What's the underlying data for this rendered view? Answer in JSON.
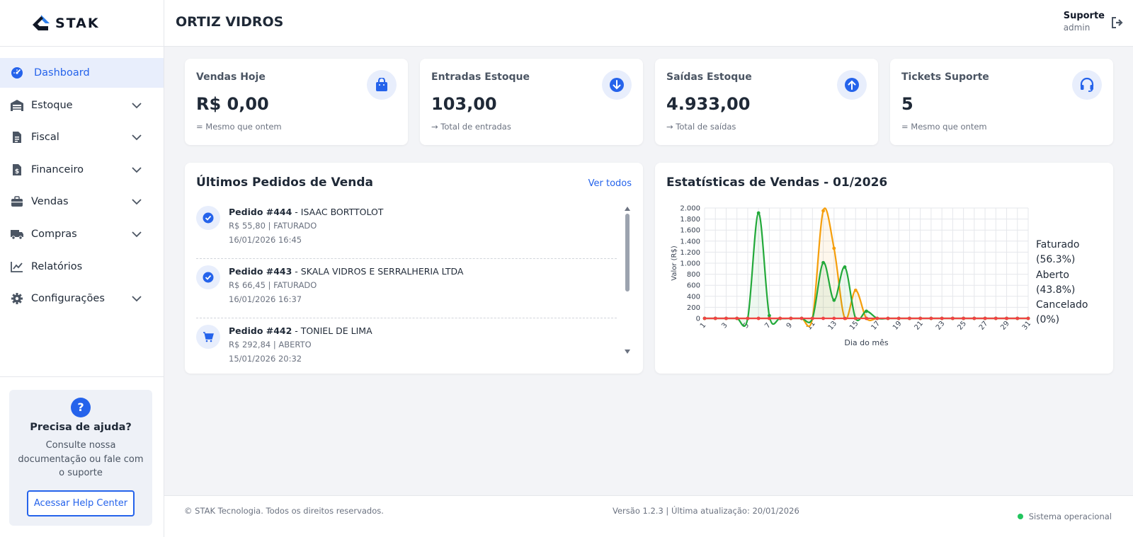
{
  "brand": {
    "name": "STAK"
  },
  "sidebar": {
    "items": [
      {
        "label": "Dashboard",
        "icon": "dashboard-icon",
        "active": true,
        "expandable": false
      },
      {
        "label": "Estoque",
        "icon": "warehouse-icon",
        "expandable": true
      },
      {
        "label": "Fiscal",
        "icon": "document-icon",
        "expandable": true
      },
      {
        "label": "Financeiro",
        "icon": "invoice-dollar-icon",
        "expandable": true
      },
      {
        "label": "Vendas",
        "icon": "briefcase-icon",
        "expandable": true
      },
      {
        "label": "Compras",
        "icon": "truck-icon",
        "expandable": true
      },
      {
        "label": "Relatórios",
        "icon": "line-chart-icon",
        "expandable": false
      },
      {
        "label": "Configurações",
        "icon": "gear-icon",
        "expandable": true
      }
    ],
    "help": {
      "icon": "?",
      "title": "Precisa de ajuda?",
      "text": "Consulte nossa documentação ou fale com o suporte",
      "button": "Acessar Help Center"
    }
  },
  "header": {
    "title": "ORTIZ VIDROS",
    "user_name": "Suporte",
    "user_role": "admin"
  },
  "stats": [
    {
      "title": "Vendas Hoje",
      "value": "R$ 0,00",
      "foot_icon": "=",
      "foot": "Mesmo que ontem",
      "icon": "shopping-bag-icon"
    },
    {
      "title": "Entradas Estoque",
      "value": "103,00",
      "foot_icon": "→",
      "foot": "Total de entradas",
      "icon": "arrow-down-circle-icon"
    },
    {
      "title": "Saídas Estoque",
      "value": "4.933,00",
      "foot_icon": "→",
      "foot": "Total de saídas",
      "icon": "arrow-up-circle-icon"
    },
    {
      "title": "Tickets Suporte",
      "value": "5",
      "foot_icon": "=",
      "foot": "Mesmo que ontem",
      "icon": "headset-icon"
    }
  ],
  "orders_panel": {
    "title": "Últimos Pedidos de Venda",
    "link": "Ver todos",
    "orders": [
      {
        "label": "Pedido #444",
        "customer": "ISAAC BORTTOLOT",
        "info": "R$ 55,80 | FATURADO",
        "date": "16/01/2026 16:45",
        "icon": "check-circle-icon"
      },
      {
        "label": "Pedido #443",
        "customer": "SKALA VIDROS E SERRALHERIA LTDA",
        "info": "R$ 66,45 | FATURADO",
        "date": "16/01/2026 16:37",
        "icon": "check-circle-icon"
      },
      {
        "label": "Pedido #442",
        "customer": "TONIEL DE LIMA",
        "info": "R$ 292,84 | ABERTO",
        "date": "15/01/2026 20:32",
        "icon": "cart-icon"
      }
    ]
  },
  "stats_panel": {
    "title": "Estatísticas de Vendas - 01/2026",
    "legend": [
      "Faturado",
      "(56.3%)",
      "Aberto",
      "(43.8%)",
      "Cancelado",
      "(0%)"
    ]
  },
  "chart_data": {
    "type": "line",
    "xlabel": "Dia do mês",
    "ylabel": "Valor (R$)",
    "x": [
      1,
      2,
      3,
      4,
      5,
      6,
      7,
      8,
      9,
      10,
      11,
      12,
      13,
      14,
      15,
      16,
      17,
      18,
      19,
      20,
      21,
      22,
      23,
      24,
      25,
      26,
      27,
      28,
      29,
      30,
      31
    ],
    "x_tick_labels": [
      "1",
      "3",
      "5",
      "7",
      "9",
      "11",
      "13",
      "15",
      "17",
      "19",
      "21",
      "23",
      "25",
      "27",
      "29",
      "31"
    ],
    "ylim": [
      0,
      2000
    ],
    "y_ticks": [
      "0",
      "200",
      "400",
      "600",
      "800",
      "1.000",
      "1.200",
      "1.400",
      "1.600",
      "1.800",
      "2.000"
    ],
    "grid": true,
    "series": [
      {
        "color": "#22a93a",
        "values": [
          0,
          0,
          0,
          0,
          0,
          1910,
          50,
          0,
          0,
          0,
          0,
          1010,
          330,
          930,
          0,
          130,
          0,
          0,
          0,
          0,
          0,
          0,
          0,
          0,
          0,
          0,
          0,
          0,
          0,
          0,
          0
        ]
      },
      {
        "color": "#f59e0b",
        "values": [
          0,
          0,
          0,
          0,
          0,
          0,
          0,
          0,
          0,
          0,
          0,
          1950,
          1270,
          0,
          510,
          0,
          0,
          0,
          0,
          0,
          0,
          0,
          0,
          0,
          0,
          0,
          0,
          0,
          0,
          0,
          0
        ]
      },
      {
        "color": "#ef4444",
        "values": [
          0,
          0,
          0,
          0,
          0,
          0,
          0,
          0,
          0,
          0,
          0,
          0,
          0,
          0,
          0,
          0,
          0,
          0,
          0,
          0,
          0,
          0,
          0,
          0,
          0,
          0,
          0,
          0,
          0,
          0,
          0
        ]
      }
    ]
  },
  "footer": {
    "copyright": "© STAK Tecnologia. Todos os direitos reservados.",
    "version": "Versão 1.2.3 | Última atualização: 20/01/2026",
    "status": "Sistema operacional"
  }
}
